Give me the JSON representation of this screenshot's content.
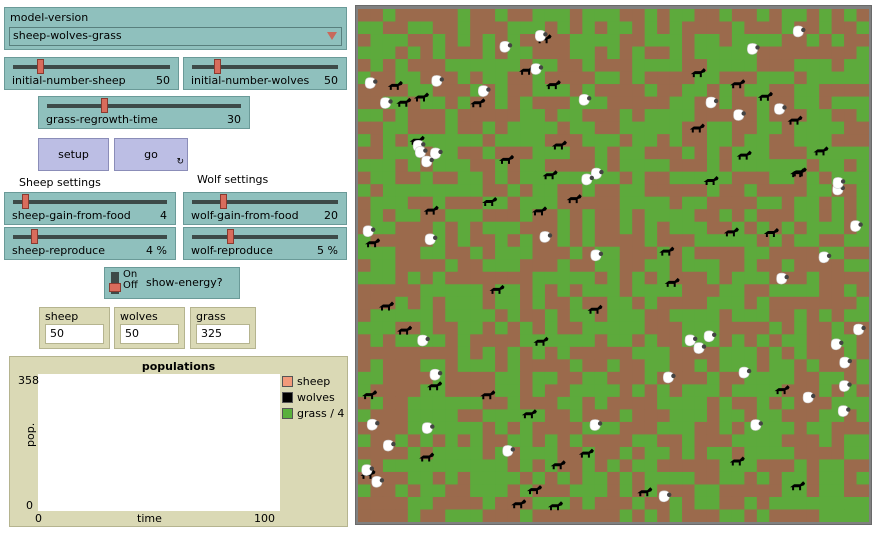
{
  "controls": {
    "model_version": {
      "label": "model-version",
      "value": "sheep-wolves-grass"
    },
    "sliders": {
      "initial_sheep": {
        "name": "initial-number-sheep",
        "value": "50",
        "fraction": 0.16
      },
      "initial_wolves": {
        "name": "initial-number-wolves",
        "value": "50",
        "fraction": 0.16
      },
      "grass_regrowth": {
        "name": "grass-regrowth-time",
        "value": "30",
        "fraction": 0.29
      },
      "sheep_gain": {
        "name": "sheep-gain-from-food",
        "value": "4",
        "fraction": 0.06
      },
      "wolf_gain": {
        "name": "wolf-gain-from-food",
        "value": "20",
        "fraction": 0.2
      },
      "sheep_reproduce": {
        "name": "sheep-reproduce",
        "value": "4 %",
        "fraction": 0.12
      },
      "wolf_reproduce": {
        "name": "wolf-reproduce",
        "value": "5 %",
        "fraction": 0.25
      }
    },
    "buttons": {
      "setup": "setup",
      "go": "go",
      "forever_glyph": "↻"
    },
    "notes": {
      "sheep": "Sheep settings",
      "wolf": "Wolf settings"
    },
    "switch": {
      "on": "On",
      "off": "Off",
      "name": "show-energy?",
      "state": "off"
    }
  },
  "monitors": {
    "sheep": {
      "label": "sheep",
      "value": "50"
    },
    "wolves": {
      "label": "wolves",
      "value": "50"
    },
    "grass": {
      "label": "grass",
      "value": "325"
    }
  },
  "plot": {
    "title": "populations",
    "ylabel": "pop.",
    "xlabel": "time",
    "ymax": "358",
    "ymin": "0",
    "xmin": "0",
    "xmax": "100",
    "legend": [
      {
        "label": "sheep",
        "color": "#f29a7a"
      },
      {
        "label": "wolves",
        "color": "#000000"
      },
      {
        "label": "grass / 4",
        "color": "#59b03c"
      }
    ]
  },
  "world": {
    "colors": {
      "grass": "#5daa3c",
      "dirt": "#9b6a4c",
      "sheep": "#ffffff",
      "wolf": "#000000"
    },
    "grid_cols": 41,
    "grid_rows": 41,
    "sheep_count": 50,
    "wolf_count": 50
  }
}
